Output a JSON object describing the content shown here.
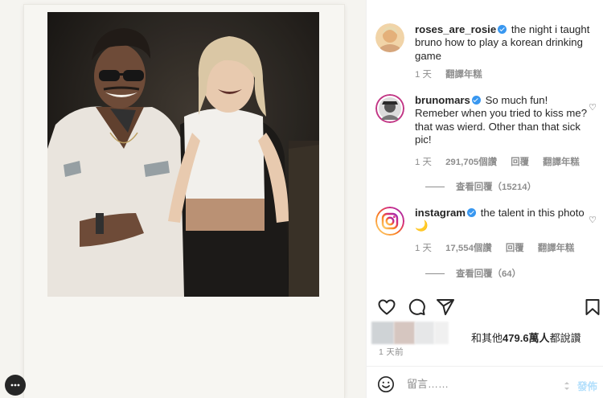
{
  "colors": {
    "accent": "#3897f0",
    "text": "#262626",
    "muted": "#8e8e8e",
    "post_disabled": "#b2dffc"
  },
  "caption": {
    "username": "roses_are_rosie",
    "text": "the night i taught bruno how to play a korean drinking game",
    "time": "1 天",
    "translate": "翻譯年糕"
  },
  "comments": [
    {
      "username": "brunomars",
      "text": "So much fun! Remeber when you tried to kiss me? that was wierd. Other than that sick pic!",
      "time": "1 天",
      "likes": "291,705個讚",
      "reply": "回覆",
      "translate": "翻譯年糕",
      "view_replies": "查看回覆（15214）"
    },
    {
      "username": "instagram",
      "text": "the talent in this photo 🌙",
      "time": "1 天",
      "likes": "17,554個讚",
      "reply": "回覆",
      "translate": "翻譯年糕",
      "view_replies": "查看回覆（64）"
    }
  ],
  "actions": {
    "like_icon": "heart-icon",
    "comment_icon": "comment-icon",
    "share_icon": "share-icon",
    "save_icon": "bookmark-icon"
  },
  "likes_summary": {
    "prefix": "和其他",
    "count": "479.6萬人",
    "suffix": "都說讚"
  },
  "post_time": "1 天前",
  "comment_box": {
    "placeholder": "留言……",
    "post_label": "發佈"
  }
}
